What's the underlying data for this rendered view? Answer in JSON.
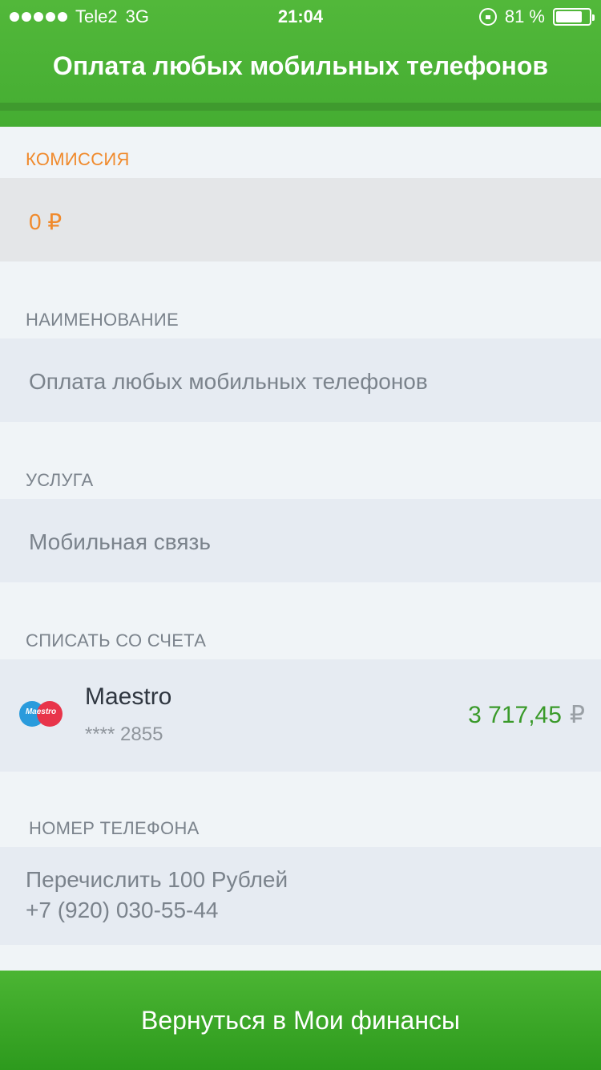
{
  "status_bar": {
    "carrier": "Tele2",
    "network": "3G",
    "time": "21:04",
    "battery_text": "81 %",
    "battery_level": 0.81
  },
  "header": {
    "title": "Оплата любых мобильных телефонов"
  },
  "commission": {
    "label": "КОМИССИЯ",
    "value": "0 ₽"
  },
  "name": {
    "label": "НАИМЕНОВАНИЕ",
    "value": "Оплата любых мобильных телефонов"
  },
  "service": {
    "label": "УСЛУГА",
    "value": "Мобильная связь"
  },
  "account": {
    "label": "СПИСАТЬ СО СЧЕТА",
    "card_brand": "Maestro",
    "card_logo_text": "Maestro",
    "card_number": "**** 2855",
    "balance": "3 717,45",
    "currency": "₽"
  },
  "phone": {
    "label": "НОМЕР ТЕЛЕФОНА",
    "line1": "Перечислить 100 Рублей",
    "line2": "+7 (920) 030-55-44"
  },
  "footer": {
    "button_label": "Вернуться в Мои финансы"
  },
  "colors": {
    "header_green": "#4cb335",
    "accent_orange": "#f08a2c",
    "balance_green": "#3a9a2a"
  }
}
